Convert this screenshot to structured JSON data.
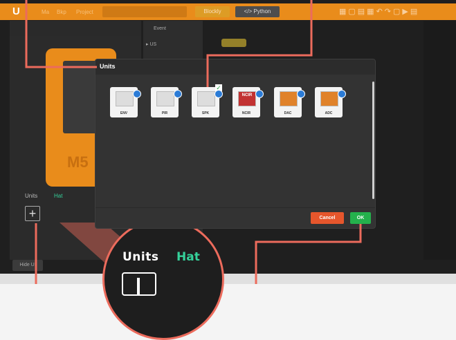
{
  "topbar": {
    "logo": "U",
    "item1": "Ma",
    "item2": "Bkp",
    "item3": "Project",
    "tab_blockly": "Blockly",
    "tab_python": "</> Python",
    "icons": "▦▢▤▦↶↷▢▶▤"
  },
  "blocks": {
    "title": "Event",
    "us": "▸ US"
  },
  "device": {
    "label": "M5"
  },
  "sidebar": {
    "units_label": "Units",
    "hat_label": "Hat",
    "hide_ui": "Hide UI"
  },
  "dialog": {
    "title": "Units",
    "units": [
      {
        "label": "ENV",
        "checked": false
      },
      {
        "label": "PIR",
        "checked": false
      },
      {
        "label": "SPK",
        "checked": true
      },
      {
        "label": "NCIR",
        "checked": false,
        "pic_text": "NCIR"
      },
      {
        "label": "DAC",
        "checked": false
      },
      {
        "label": "ADC",
        "checked": false
      }
    ],
    "cancel": "Cancel",
    "ok": "OK"
  },
  "callout": {
    "units_label": "Units",
    "hat_label": "Hat"
  },
  "colors": {
    "accent": "#e98c1b",
    "callout": "#ec6b5c",
    "hat": "#35d19a",
    "ok": "#24b14c",
    "cancel": "#e6562c"
  }
}
